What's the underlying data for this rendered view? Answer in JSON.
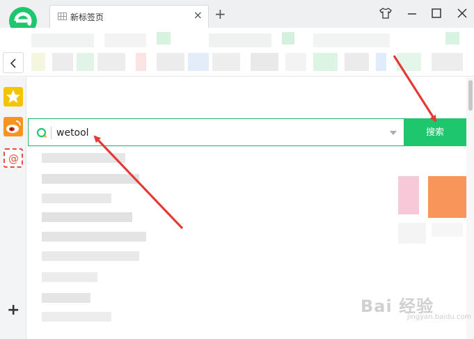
{
  "window": {
    "tab_title": "新标签页",
    "tab_close": "×",
    "new_tab": "+"
  },
  "sidebar": {
    "add_label": "+"
  },
  "search": {
    "value": "wetool",
    "button_label": "搜索"
  },
  "colors": {
    "brand_green": "#1ec66d",
    "search_border": "#1bb35e",
    "arrow_red": "#e53935"
  },
  "watermark": {
    "text": "Bai 经验",
    "sub": "jingyan.baidu.com"
  }
}
